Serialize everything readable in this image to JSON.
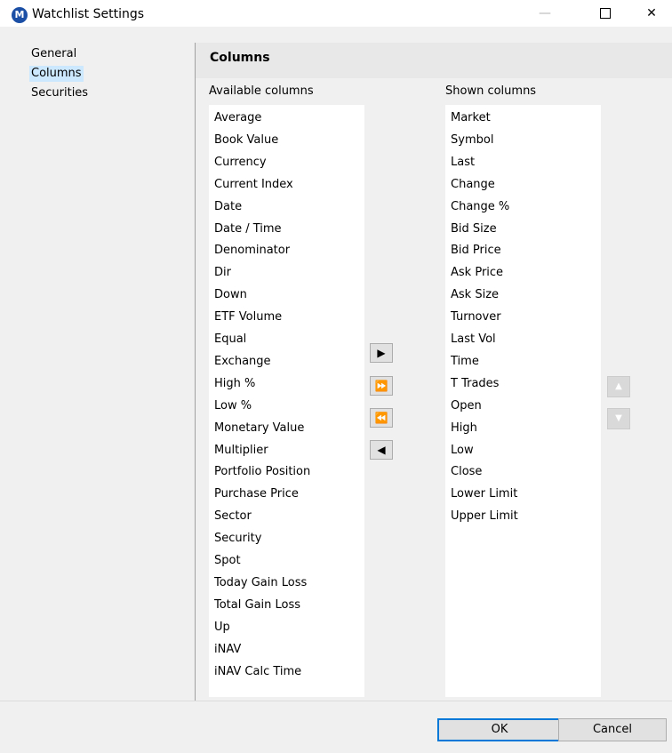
{
  "window": {
    "title": "Watchlist Settings",
    "app_icon": "M",
    "controls": {
      "minimize": "—",
      "close": "✕"
    }
  },
  "nav": {
    "items": [
      {
        "label": "General",
        "selected": false
      },
      {
        "label": "Columns",
        "selected": true
      },
      {
        "label": "Securities",
        "selected": false
      }
    ]
  },
  "section": {
    "title": "Columns"
  },
  "available": {
    "label": "Available columns",
    "items": [
      "Average",
      "Book Value",
      "Currency",
      "Current Index",
      "Date",
      "Date / Time",
      "Denominator",
      "Dir",
      "Down",
      "ETF Volume",
      "Equal",
      "Exchange",
      "High %",
      "Low %",
      "Monetary Value",
      "Multiplier",
      "Portfolio Position",
      "Purchase Price",
      "Sector",
      "Security",
      "Spot",
      "Today Gain Loss",
      "Total Gain Loss",
      "Up",
      "iNAV",
      "iNAV Calc Time"
    ]
  },
  "shown": {
    "label": "Shown columns",
    "items": [
      "Market",
      "Symbol",
      "Last",
      "Change",
      "Change %",
      "Bid Size",
      "Bid Price",
      "Ask Price",
      "Ask Size",
      "Turnover",
      "Last Vol",
      "Time",
      "T Trades",
      "Open",
      "High",
      "Low",
      "Close",
      "Lower Limit",
      "Upper Limit"
    ]
  },
  "move_buttons": {
    "add": "▶",
    "add_all": "⏩",
    "remove_all": "⏪",
    "remove": "◀"
  },
  "order_buttons": {
    "up": "▲",
    "down": "▼"
  },
  "footer": {
    "ok": "OK",
    "cancel": "Cancel"
  }
}
